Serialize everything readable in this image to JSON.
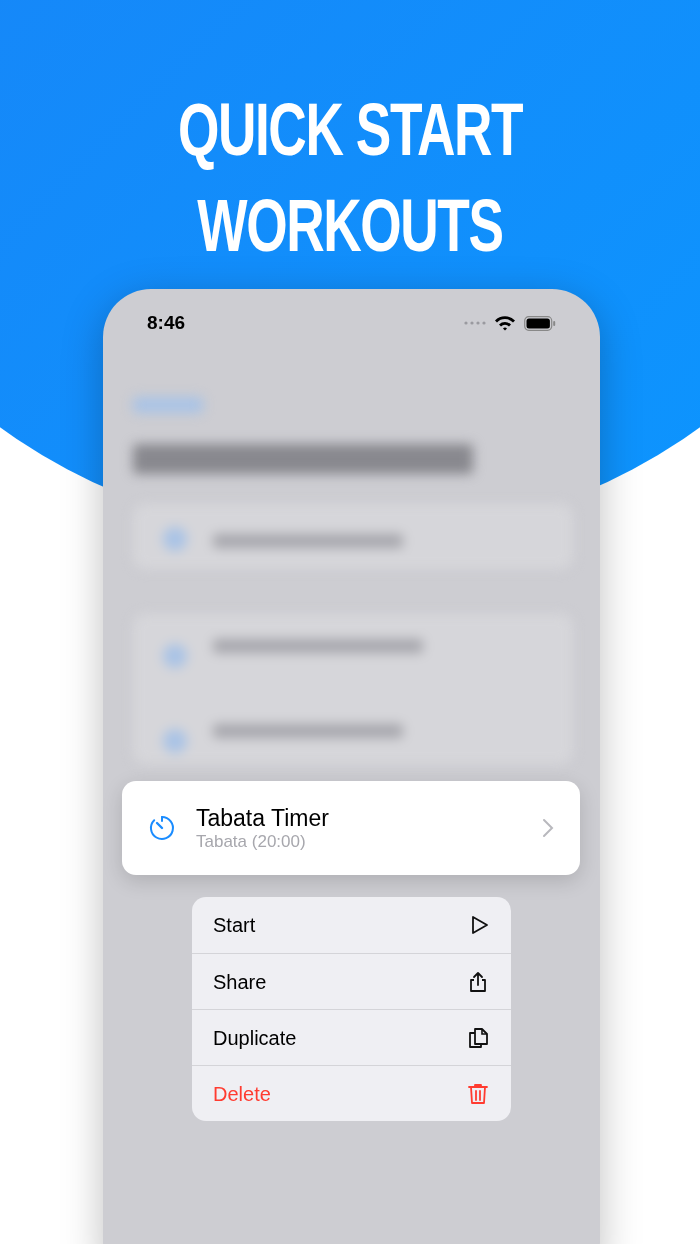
{
  "headline": [
    "QUICK START",
    "WORKOUTS"
  ],
  "status_bar": {
    "time": "8:46"
  },
  "selected_workout": {
    "title": "Tabata Timer",
    "subtitle": "Tabata (20:00)"
  },
  "context_menu": [
    {
      "label": "Start",
      "kind": "normal"
    },
    {
      "label": "Share",
      "kind": "normal"
    },
    {
      "label": "Duplicate",
      "kind": "normal"
    },
    {
      "label": "Delete",
      "kind": "destructive"
    }
  ]
}
